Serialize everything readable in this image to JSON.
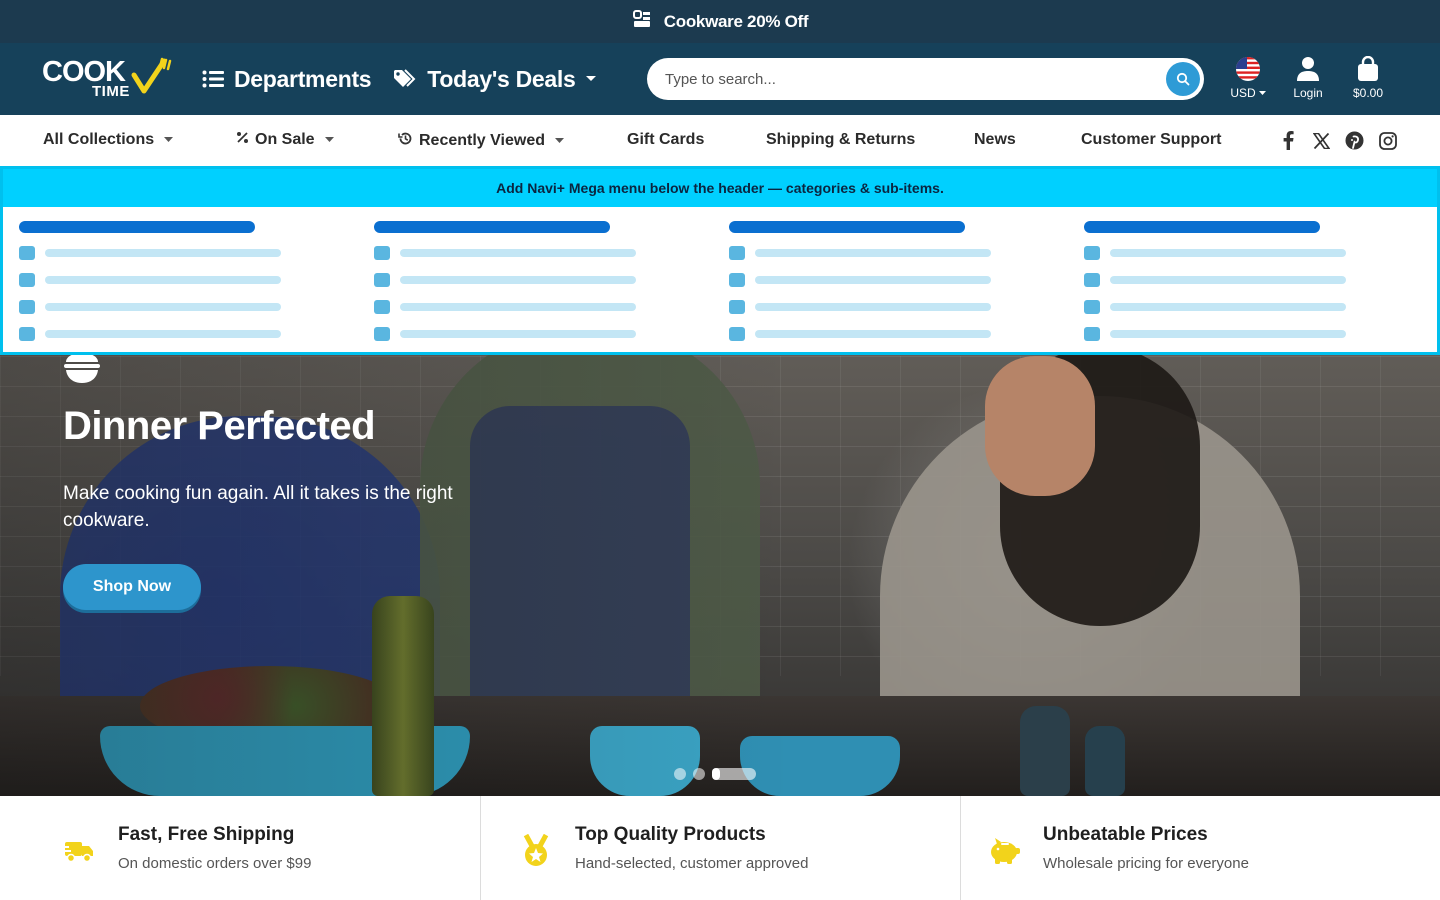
{
  "announcement": {
    "text": "Cookware 20% Off"
  },
  "header": {
    "logo": {
      "line1": "COOK",
      "line2": "TIME"
    },
    "departments_label": "Departments",
    "deals_label": "Today's Deals",
    "search": {
      "placeholder": "Type to search..."
    },
    "currency_label": "USD",
    "login_label": "Login",
    "cart_total": "$0.00"
  },
  "subnav": {
    "items": [
      {
        "label": "All Collections"
      },
      {
        "label": "On Sale"
      },
      {
        "label": "Recently Viewed"
      },
      {
        "label": "Gift Cards"
      },
      {
        "label": "Shipping & Returns"
      },
      {
        "label": "News"
      },
      {
        "label": "Customer Support"
      }
    ],
    "social": [
      "facebook-icon",
      "x-icon",
      "pinterest-icon",
      "instagram-icon"
    ]
  },
  "mega_menu": {
    "notice": "Add Navi+ Mega menu below the header — categories & sub-items."
  },
  "hero": {
    "title": "Dinner Perfected",
    "subtitle": "Make cooking fun again. All it takes is the right cookware.",
    "button_label": "Shop Now",
    "slide_count": 3,
    "active_slide": 3
  },
  "features": [
    {
      "icon": "truck-icon",
      "title": "Fast, Free Shipping",
      "subtitle": "On domestic orders over $99"
    },
    {
      "icon": "medal-icon",
      "title": "Top Quality Products",
      "subtitle": "Hand-selected, customer approved"
    },
    {
      "icon": "piggy-bank-icon",
      "title": "Unbeatable Prices",
      "subtitle": "Wholesale pricing for everyone"
    }
  ],
  "colors": {
    "announcement_bg": "#1c3a4f",
    "header_bg": "#16415a",
    "accent_blue": "#2d95cc",
    "accent_yellow": "#f2d31b",
    "mega_bar": "#00d0ff"
  }
}
